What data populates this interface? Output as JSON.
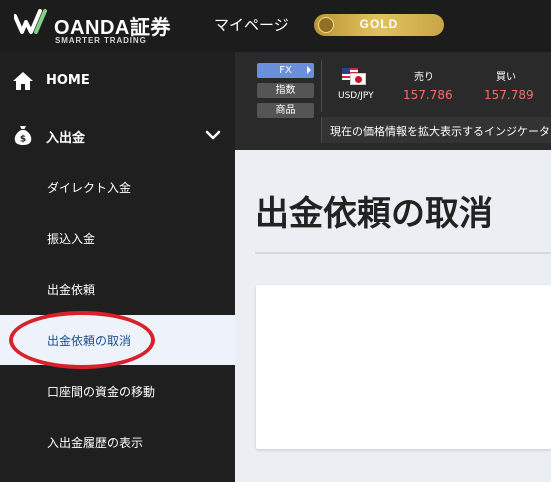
{
  "header": {
    "brand": "OANDA証券",
    "tagline": "SMARTER TRADING",
    "mypage_label": "マイページ",
    "badge_label": "GOLD",
    "badge_color": "#c9a84a"
  },
  "sidebar": {
    "home": {
      "label": "HOME",
      "icon": "home-icon"
    },
    "deposit": {
      "label": "入出金",
      "icon": "money-bag-icon",
      "expanded": true
    },
    "items": [
      {
        "label": "ダイレクト入金",
        "active": false
      },
      {
        "label": "振込入金",
        "active": false
      },
      {
        "label": "出金依頼",
        "active": false
      },
      {
        "label": "出金依頼の取消",
        "active": true
      },
      {
        "label": "口座間の資金の移動",
        "active": false
      },
      {
        "label": "入出金履歴の表示",
        "active": false
      }
    ],
    "annotation_color": "#d8212b"
  },
  "rates": {
    "tabs": [
      {
        "label": "FX",
        "active": true
      },
      {
        "label": "指数",
        "active": false
      },
      {
        "label": "商品",
        "active": false
      }
    ],
    "pair": "USD/JPY",
    "sell_label": "売り",
    "sell_value": "157.786",
    "buy_label": "買い",
    "buy_value": "157.789",
    "ticker": "現在の価格情報を拡大表示するインジケーター"
  },
  "main": {
    "title": "出金依頼の取消"
  },
  "colors": {
    "header_bg": "#1c1c1c",
    "sidebar_bg": "#1f1f1f",
    "active_bg": "#eef3fb",
    "accent_blue": "#6b8fdc",
    "rate_red": "#ff6b6b"
  }
}
